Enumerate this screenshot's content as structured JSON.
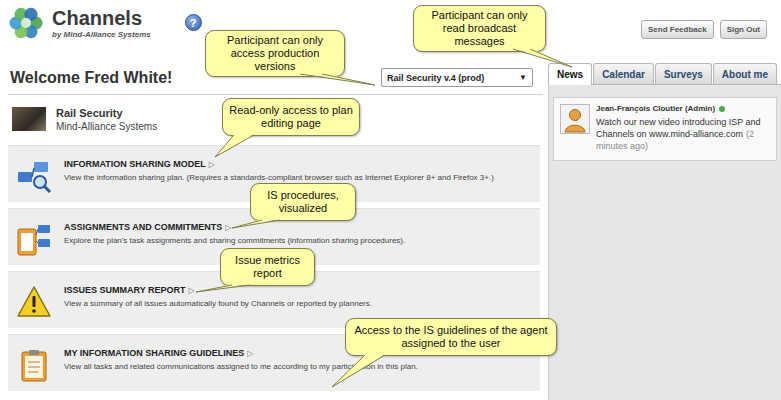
{
  "header": {
    "app_name": "Channels",
    "byline": "by Mind-Alliance Systems",
    "help": "?",
    "buttons": [
      "Send Feedback",
      "Sign Out"
    ]
  },
  "welcome": "Welcome Fred White!",
  "plan_select": {
    "value": "Rail Security v.4 (prod)",
    "arrow": "▼"
  },
  "plan": {
    "name": "Rail Security",
    "owner": "Mind-Alliance Systems"
  },
  "sections": [
    {
      "kind": "model",
      "title": "INFORMATION SHARING MODEL",
      "arrow": "▷",
      "description": "View the information sharing plan. (Requires a standards-compliant browser such as Internet Explorer 8+ and Firefox 3+.)"
    },
    {
      "kind": "assignments",
      "title": "ASSIGNMENTS AND COMMITMENTS",
      "arrow": "▷",
      "description": "Explore the plan's task assignments and sharing commitments (information sharing procedures)."
    },
    {
      "kind": "issues",
      "title": "ISSUES SUMMARY REPORT",
      "arrow": "▷",
      "description": "View a summary of all issues automatically found by Channels or reported by planners."
    },
    {
      "kind": "guidelines",
      "title": "MY INFORMATION SHARING GUIDELINES",
      "arrow": "▷",
      "description": "View all tasks and related communications assigned to me according to my participation in this plan."
    }
  ],
  "tabs": [
    {
      "label": "News",
      "selected": true
    },
    {
      "label": "Calendar",
      "selected": false
    },
    {
      "label": "Surveys",
      "selected": false
    },
    {
      "label": "About me",
      "selected": false
    }
  ],
  "messages": [
    {
      "author": "Jean-François Cloutier (Admin)",
      "online": true,
      "text": "Watch our new video introducing ISP and Channels on www.mind-alliance.com",
      "time": "(2 minutes ago)"
    }
  ],
  "callouts": [
    {
      "text": "Participant can only access production versions"
    },
    {
      "text": "Participant can only read broadcast messages"
    },
    {
      "text": "Read-only access to plan editing page"
    },
    {
      "text": "IS procedures, visualized"
    },
    {
      "text": "Issue metrics report"
    },
    {
      "text": "Access to the IS guidelines of the agent assigned to the user"
    }
  ]
}
